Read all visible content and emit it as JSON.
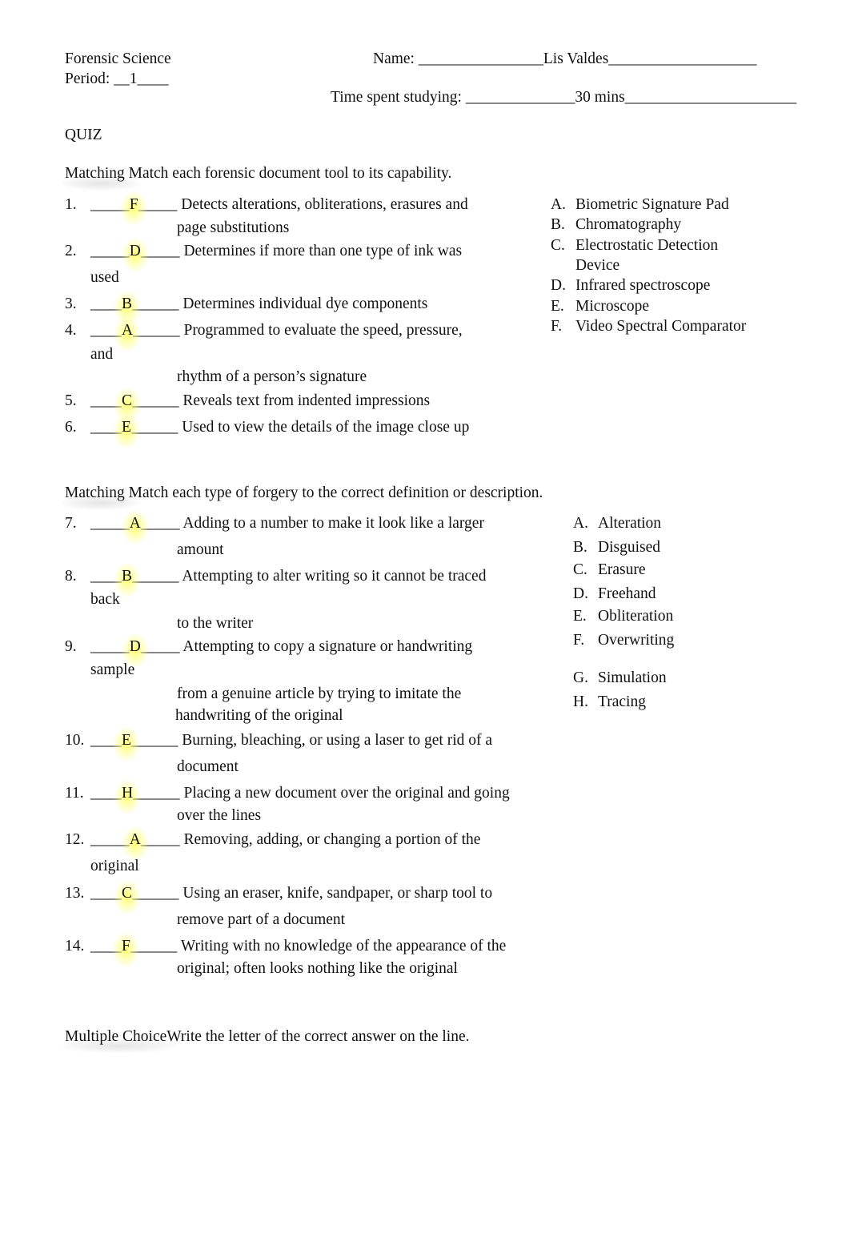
{
  "header": {
    "course": "Forensic Science",
    "name_label": "Name: ",
    "name_blank_before": "________________",
    "name_value": "Lis Valdes",
    "name_blank_after": "___________________",
    "period_label": "Period: ",
    "period_blank_before": "__",
    "period_value": "1",
    "period_blank_after": "____",
    "time_label": "Time spent studying: ",
    "time_blank_before": "______________",
    "time_value": "30 mins",
    "time_blank_after": "______________________",
    "quiz_title": "QUIZ"
  },
  "section1": {
    "heading": "Matching Match each forensic document tool to its capability.",
    "questions": [
      {
        "num": "1.",
        "pre": "_____",
        "answer": "F",
        "post": "_____",
        "text": " Detects alterations, obliterations, erasures and",
        "cont": [
          "page substitutions"
        ]
      },
      {
        "num": "2.",
        "pre": "_____",
        "answer": "D",
        "post": "_____",
        "text": " Determines if more than one type of ink was",
        "cont": [
          "used"
        ]
      },
      {
        "num": "3.",
        "pre": "____",
        "answer": "B",
        "post": "______",
        "text": " Determines individual dye components",
        "cont": []
      },
      {
        "num": "4.",
        "pre": "____",
        "answer": "A",
        "post": "______",
        "text": " Programmed to evaluate the speed, pressure,",
        "cont": [
          "and",
          "rhythm of a person’s signature"
        ]
      },
      {
        "num": "5.",
        "pre": "____",
        "answer": "C",
        "post": "______",
        "text": " Reveals text from indented impressions",
        "cont": []
      },
      {
        "num": "6.",
        "pre": "____",
        "answer": "E",
        "post": "______",
        "text": " Used to view the details of the image close up",
        "cont": []
      }
    ],
    "choices": [
      {
        "letter": "A.",
        "text": "Biometric Signature Pad"
      },
      {
        "letter": "B.",
        "text": "Chromatography"
      },
      {
        "letter": "C.",
        "text": "Electrostatic Detection",
        "cont": "Device"
      },
      {
        "letter": "D.",
        "text": "Infrared spectroscope"
      },
      {
        "letter": "E.",
        "text": "Microscope"
      },
      {
        "letter": "F.",
        "text": "Video Spectral Comparator"
      }
    ]
  },
  "section2": {
    "heading": "Matching Match each type of forgery to the correct definition or description.",
    "questions": [
      {
        "num": "7.",
        "pre": "_____",
        "answer": "A",
        "post": "_____",
        "text": " Adding to a number to make it look like a larger",
        "cont": [
          "amount"
        ]
      },
      {
        "num": "8.",
        "pre": "____",
        "answer": "B",
        "post": "______",
        "text": " Attempting to alter writing so it cannot be traced",
        "cont": [
          "back",
          "to the writer"
        ]
      },
      {
        "num": "9.",
        "pre": "_____",
        "answer": "D",
        "post": "_____",
        "text": " Attempting to copy a signature or handwriting",
        "cont": [
          "sample",
          "from a genuine article by trying to imitate the",
          "handwriting of the original"
        ]
      },
      {
        "num": "10.",
        "pre": "____",
        "answer": "E",
        "post": "______",
        "text": " Burning, bleaching, or using a laser to get rid of a",
        "cont": [
          "document"
        ]
      },
      {
        "num": "11.",
        "pre": "____",
        "answer": "H",
        "post": "______",
        "text": " Placing a new document over the original and going",
        "cont": [
          "over the lines"
        ]
      },
      {
        "num": "12.",
        "pre": "_____",
        "answer": "A",
        "post": "_____",
        "text": " Removing, adding, or changing a portion of the",
        "cont": [
          "original"
        ]
      },
      {
        "num": "13.",
        "pre": "____",
        "answer": "C",
        "post": "______",
        "text": " Using an eraser, knife, sandpaper, or sharp tool to",
        "cont": [
          "remove part of a document"
        ]
      },
      {
        "num": "14.",
        "pre": "____",
        "answer": "F",
        "post": "______",
        "text": " Writing with no knowledge of the appearance of the",
        "cont": [
          "original; often looks nothing like the original"
        ]
      }
    ],
    "choices": [
      {
        "letter": "A.",
        "text": "Alteration"
      },
      {
        "letter": "B.",
        "text": "Disguised"
      },
      {
        "letter": "C.",
        "text": "Erasure"
      },
      {
        "letter": "D.",
        "text": "Freehand"
      },
      {
        "letter": "E.",
        "text": "Obliteration"
      },
      {
        "letter": "F.",
        "text": "Overwriting"
      },
      {
        "letter": "G.",
        "text": "Simulation"
      },
      {
        "letter": "H.",
        "text": "Tracing"
      }
    ]
  },
  "section3": {
    "heading_label": "Multiple Choice",
    "heading_text": "Write the letter of the correct answer on the line."
  },
  "colors": {
    "text": "#111111",
    "highlight": "#ffff5a"
  }
}
